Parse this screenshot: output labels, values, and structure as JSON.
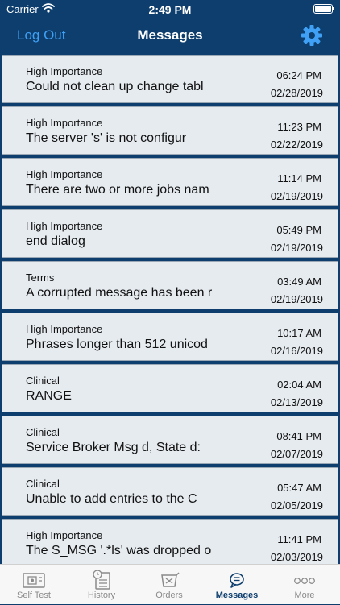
{
  "status": {
    "carrier": "Carrier",
    "time": "2:49 PM"
  },
  "nav": {
    "left_label": "Log Out",
    "title": "Messages"
  },
  "messages": [
    {
      "category": "High Importance",
      "text": "Could not clean up change tabl",
      "time": "06:24 PM",
      "date": "02/28/2019"
    },
    {
      "category": "High Importance",
      "text": "The server 's' is not configur",
      "time": "11:23 PM",
      "date": "02/22/2019"
    },
    {
      "category": "High Importance",
      "text": "There are two or more jobs nam",
      "time": "11:14 PM",
      "date": "02/19/2019"
    },
    {
      "category": "High Importance",
      "text": "end dialog",
      "time": "05:49 PM",
      "date": "02/19/2019"
    },
    {
      "category": "Terms",
      "text": "A corrupted message has been r",
      "time": "03:49 AM",
      "date": "02/19/2019"
    },
    {
      "category": "High Importance",
      "text": "Phrases longer than 512 unicod",
      "time": "10:17 AM",
      "date": "02/16/2019"
    },
    {
      "category": "Clinical",
      "text": "RANGE",
      "time": "02:04 AM",
      "date": "02/13/2019"
    },
    {
      "category": "Clinical",
      "text": "Service Broker Msg d, State d:",
      "time": "08:41 PM",
      "date": "02/07/2019"
    },
    {
      "category": "Clinical",
      "text": "Unable to add entries to the C",
      "time": "05:47 AM",
      "date": "02/05/2019"
    },
    {
      "category": "High Importance",
      "text": "The S_MSG '.*ls' was dropped o",
      "time": "11:41 PM",
      "date": "02/03/2019"
    }
  ],
  "tabs": [
    {
      "label": "Self Test",
      "icon": "self-test-icon"
    },
    {
      "label": "History",
      "icon": "history-icon"
    },
    {
      "label": "Orders",
      "icon": "orders-icon"
    },
    {
      "label": "Messages",
      "icon": "messages-icon",
      "active": true
    },
    {
      "label": "More",
      "icon": "more-icon"
    }
  ],
  "colors": {
    "nav_background": "#0d3e6e",
    "accent": "#3fa0f5",
    "card_background": "#e6ebf0",
    "tab_active": "#0d3e6e",
    "tab_inactive": "#8a8a8a"
  }
}
